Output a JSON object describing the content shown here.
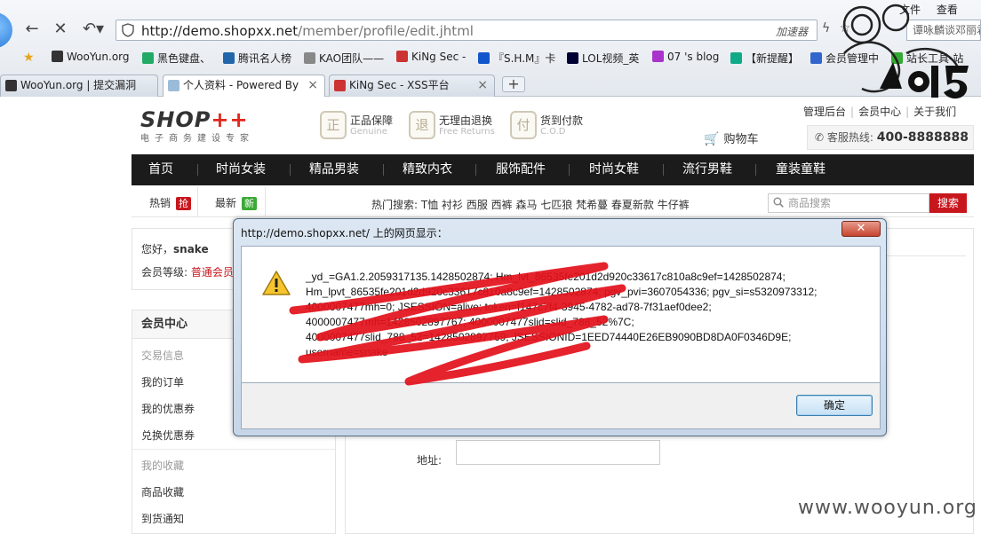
{
  "browser": {
    "url_host": "http://demo.shopxx.net",
    "url_path": "/member/profile/edit.jhtml",
    "accelerator": "加速器",
    "search_text": "谭咏麟谈邓丽君",
    "menu": [
      "文件",
      "查看"
    ],
    "bookmarks": [
      {
        "label": "WooYun.org",
        "color": "#333"
      },
      {
        "label": "黑色键盘、",
        "color": "#2a6"
      },
      {
        "label": "腾讯名人榜",
        "color": "#26a"
      },
      {
        "label": "KAO团队——",
        "color": "#888"
      },
      {
        "label": "KiNg Sec -",
        "color": "#c33"
      },
      {
        "label": "『S.H.M』卡",
        "color": "#15c"
      },
      {
        "label": "LOL视频_英",
        "color": "#003"
      },
      {
        "label": "07 's blog",
        "color": "#a3c"
      },
      {
        "label": "【新提醒】",
        "color": "#1a8"
      },
      {
        "label": "会员管理中",
        "color": "#36c"
      },
      {
        "label": "站长工具-站",
        "color": "#3a3"
      }
    ],
    "tabs": [
      {
        "label": "WooYun.org | 提交漏洞",
        "active": false
      },
      {
        "label": "个人资料 - Powered By",
        "active": true
      },
      {
        "label": "KiNg Sec - XSS平台",
        "active": false
      }
    ]
  },
  "header": {
    "logo": "SHOP",
    "logo_plus": "++",
    "tagline": "电子商务建设专家",
    "guarantees": [
      {
        "icon": "正",
        "title": "正品保障",
        "sub": "Genuine"
      },
      {
        "icon": "退",
        "title": "无理由退换",
        "sub": "Free Returns"
      },
      {
        "icon": "付",
        "title": "货到付款",
        "sub": "C.O.D"
      }
    ],
    "top_links": [
      "管理后台",
      "会员中心",
      "关于我们"
    ],
    "cart": "购物车",
    "hotline_label": "客服热线:",
    "hotline_number": "400-8888888"
  },
  "nav": [
    "首页",
    "时尚女装",
    "精品男装",
    "精致内衣",
    "服饰配件",
    "时尚女鞋",
    "流行男鞋",
    "童装童鞋"
  ],
  "subbar": {
    "hot": "热销",
    "hot_tag": "抢",
    "new": "最新",
    "new_tag": "新",
    "hot_search": "热门搜索: T恤 衬衫 西服 西裤 森马 七匹狼 梵希蔓 春夏新款 牛仔裤",
    "search_placeholder": "商品搜索",
    "search_button": "搜索"
  },
  "member": {
    "hello": "您好，",
    "username": "snake",
    "level_label": "会员等级:",
    "level_value": "普通会员",
    "menu_title": "会员中心",
    "groups": [
      {
        "title": "交易信息",
        "items": [
          "我的订单",
          "我的优惠券",
          "兑换优惠券"
        ]
      },
      {
        "title": "我的收藏",
        "items": [
          "商品收藏",
          "到货通知"
        ]
      }
    ]
  },
  "form": {
    "address_label": "地址:"
  },
  "dialog": {
    "title": "http://demo.shopxx.net/ 上的网页显示：",
    "close": "✕",
    "lines": [
      "_yd_=GA1.2.2059317135.1428502874; Hm_lvt_86535fe201d2d920c33617c810a8c9ef=1428502874;",
      "Hm_lpvt_86535fe201d2d920c33617c810a8c9ef=1428502874; pgv_pvi=3607054336; pgv_si=s5320973312;",
      "4000007477mh=0; JSESSION=alive; token=f147c7f4-3945-4782-ad78-7f31aef0dee2;",
      "4000007477mh=1428502897767; 4000007477slid=slid_788_52%7C;",
      "4000007477slid_788_52=1428502897769; JSESSIONID=1EED74440E26EB9090BD8DA0F0346D9E;",
      "username=snake"
    ],
    "ok": "确定"
  },
  "watermark": "www.wooyun.org"
}
